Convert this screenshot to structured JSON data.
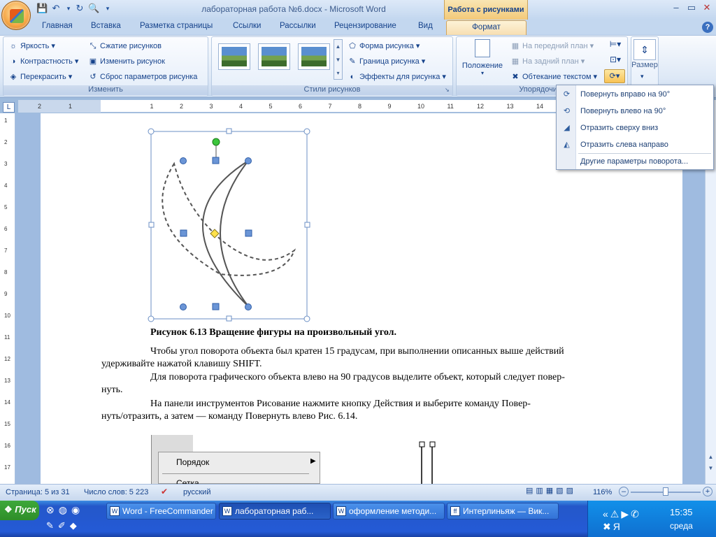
{
  "window": {
    "title": "лабораторная работа №6.docx - Microsoft Word",
    "context_tab_group": "Работа с рисунками"
  },
  "tabs": [
    "Главная",
    "Вставка",
    "Разметка страницы",
    "Ссылки",
    "Рассылки",
    "Рецензирование",
    "Вид",
    "Формат"
  ],
  "ribbon": {
    "adjust": {
      "label": "Изменить",
      "brightness": "Яркость",
      "contrast": "Контрастность",
      "recolor": "Перекрасить",
      "compress": "Сжатие рисунков",
      "change": "Изменить рисунок",
      "reset": "Сброс параметров рисунка"
    },
    "styles": {
      "label": "Стили рисунков",
      "shape": "Форма рисунка",
      "border": "Граница рисунка",
      "effects": "Эффекты для рисунка"
    },
    "arrange": {
      "label": "Упорядочить",
      "position": "Положение",
      "front": "На передний план",
      "back": "На задний план",
      "wrap": "Обтекание текстом"
    },
    "size": {
      "label": "Размер"
    }
  },
  "rotate_menu": {
    "items": [
      {
        "label": "Повернуть вправо на 90°",
        "icon": "rotate-right-icon"
      },
      {
        "label": "Повернуть влево на 90°",
        "icon": "rotate-left-icon"
      },
      {
        "label": "Отразить сверху вниз",
        "icon": "flip-vertical-icon"
      },
      {
        "label": "Отразить слева направо",
        "icon": "flip-horizontal-icon"
      }
    ],
    "more": "Другие параметры поворота..."
  },
  "ruler": {
    "h_numbers": [
      "2",
      "1",
      "1",
      "2",
      "3",
      "4",
      "5",
      "6",
      "7",
      "8",
      "9",
      "10",
      "11",
      "12",
      "13",
      "14"
    ],
    "v_numbers": [
      "1",
      "2",
      "3",
      "4",
      "5",
      "6",
      "7",
      "8",
      "9",
      "10",
      "11",
      "12",
      "13",
      "14",
      "15",
      "16",
      "17"
    ]
  },
  "document": {
    "caption": "Рисунок 6.13 Вращение фигуры на произвольный угол.",
    "para1_l1": "Чтобы угол поворота объекта был кратен 15 градусам, при выполнении описанных выше действий",
    "para1_l2": "удерживайте нажатой клавишу SHIFT.",
    "para2_l1": "Для поворота графического объекта влево на 90 градусов выделите объект, который следует повер-",
    "para2_l2": "нуть.",
    "para3_l1": "На панели инструментов Рисование нажмите кнопку Действия и выберите команду Повер-",
    "para3_l2": "нуть/отразить, а затем — команду Повернуть влево Рис. 6.14.",
    "fig2_menu_item": "Порядок",
    "fig2_menu_item2": "Сетка..."
  },
  "statusbar": {
    "page": "Страница: 5 из 31",
    "words": "Число слов: 5 223",
    "lang": "русский",
    "zoom": "116%"
  },
  "taskbar": {
    "start": "Пуск",
    "buttons": [
      "Word - FreeCommander",
      "лабораторная раб...",
      "оформление методи...",
      "Интерлиньяж — Вик..."
    ],
    "lang": "RU",
    "time": "15:35",
    "day": "среда"
  },
  "colors": {
    "ribbon_bg": "#dde8f6",
    "context_tab": "#f7deaf",
    "taskbar": "#245ad6",
    "selection_handle": "#6b95d6"
  }
}
